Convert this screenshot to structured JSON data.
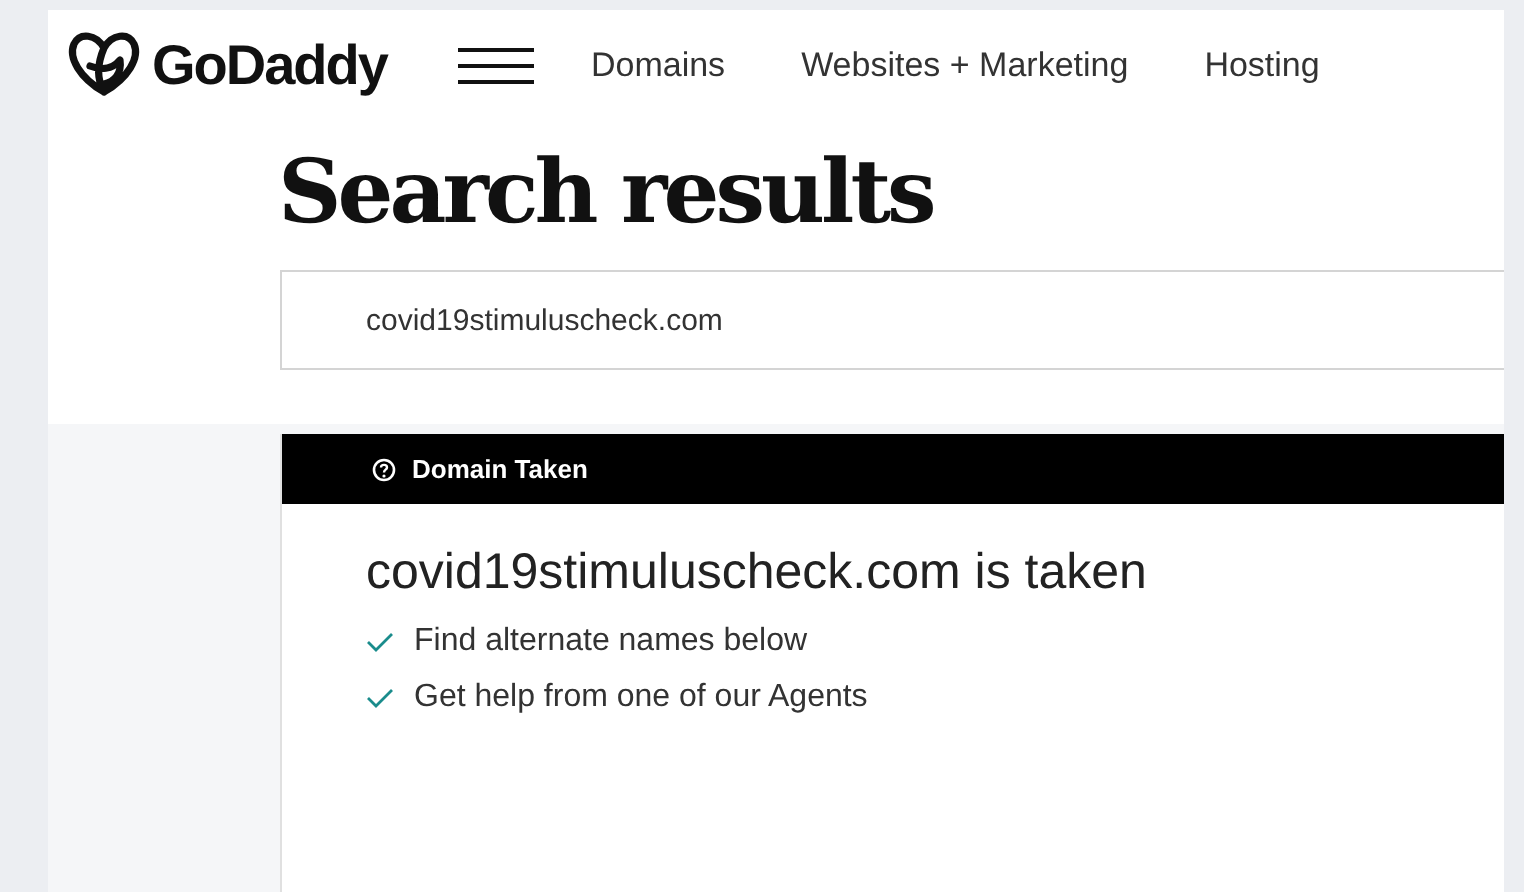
{
  "header": {
    "logo_text": "GoDaddy",
    "nav": [
      "Domains",
      "Websites + Marketing",
      "Hosting"
    ]
  },
  "title": "Search results",
  "search": {
    "value": "covid19stimuluscheck.com"
  },
  "result": {
    "banner": "Domain Taken",
    "heading": "covid19stimuluscheck.com is taken",
    "points": [
      "Find alternate names below",
      "Get help from one of our Agents"
    ]
  }
}
